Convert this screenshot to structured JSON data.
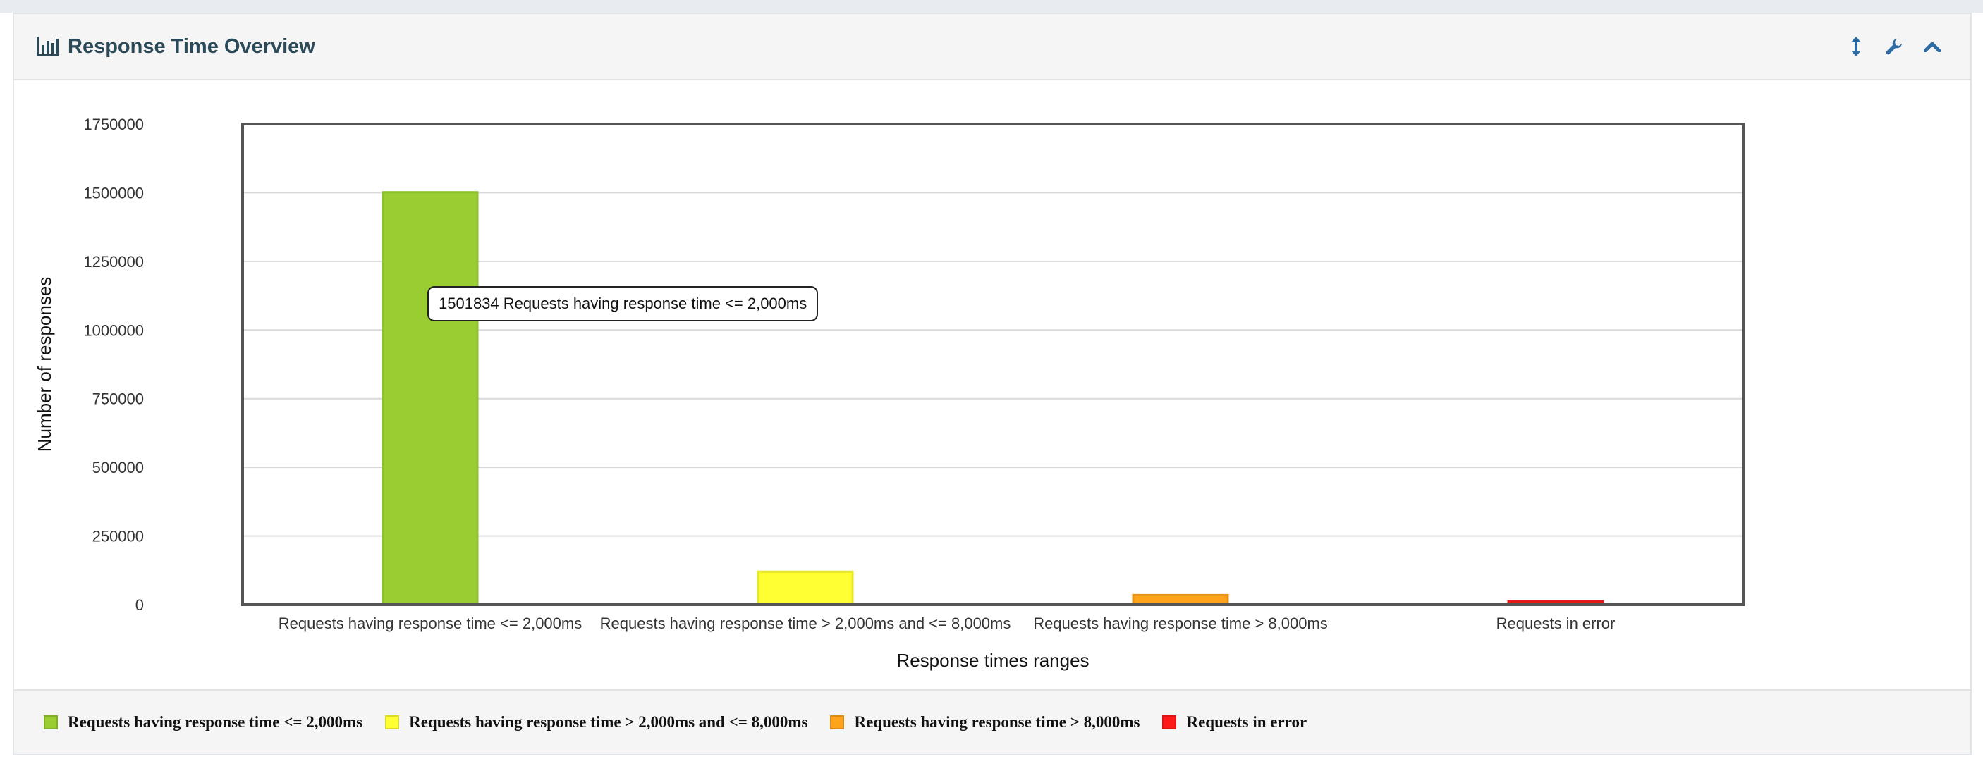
{
  "panel": {
    "title": "Response Time Overview",
    "icons": {
      "title_icon": "bar-chart-icon",
      "tools": [
        "vertical-resize-icon",
        "wrench-icon",
        "chevron-up-icon"
      ]
    }
  },
  "tooltip": {
    "text": "1501834 Requests having response time <= 2,000ms"
  },
  "chart_data": {
    "type": "bar",
    "categories": [
      "Requests having response time <= 2,000ms",
      "Requests having response time > 2,000ms and <= 8,000ms",
      "Requests having response time > 8,000ms",
      "Requests in error"
    ],
    "values": [
      1501834,
      120000,
      35000,
      12000
    ],
    "colors": [
      "#9acd32",
      "#ffff33",
      "#ffa31a",
      "#ff1a1a"
    ],
    "border_colors": [
      "#8bc12a",
      "#e6e62e",
      "#e8931a",
      "#e61717"
    ],
    "title": "",
    "xlabel": "Response times ranges",
    "ylabel": "Number of responses",
    "ylim": [
      0,
      1750000
    ],
    "yticks": [
      0,
      250000,
      500000,
      750000,
      1000000,
      1250000,
      1500000,
      1750000
    ],
    "grid": true,
    "legend": {
      "placement": "bottom",
      "items": [
        "Requests having response time <= 2,000ms",
        "Requests having response time > 2,000ms and <= 8,000ms",
        "Requests having response time > 8,000ms",
        "Requests in error"
      ]
    }
  }
}
